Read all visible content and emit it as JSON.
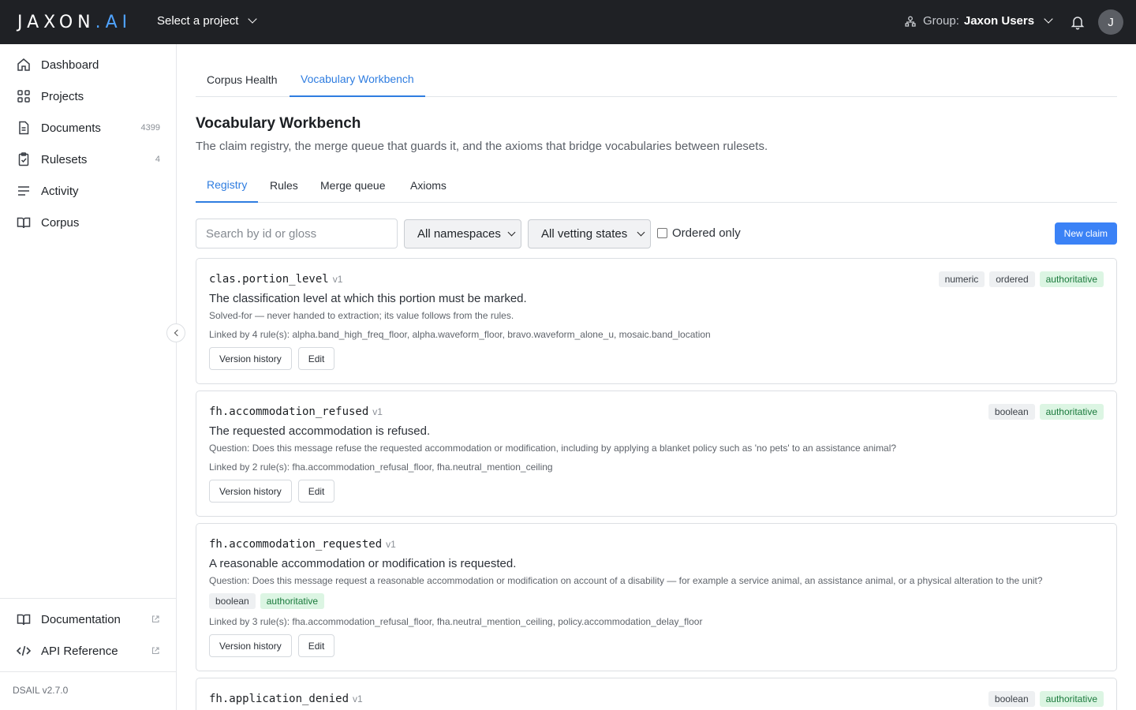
{
  "app": {
    "logo_main": "JAXON",
    "logo_dot": ".",
    "logo_accent": "AI",
    "project_select": "Select a project",
    "group_label": "Group:",
    "group_name": "Jaxon Users",
    "avatar_initial": "J"
  },
  "sidebar": {
    "items": [
      {
        "label": "Dashboard",
        "count": ""
      },
      {
        "label": "Projects",
        "count": ""
      },
      {
        "label": "Documents",
        "count": "4399"
      },
      {
        "label": "Rulesets",
        "count": "4"
      },
      {
        "label": "Activity",
        "count": ""
      },
      {
        "label": "Corpus",
        "count": ""
      }
    ],
    "bottom": [
      {
        "label": "Documentation"
      },
      {
        "label": "API Reference"
      }
    ],
    "version": "DSAIL v2.7.0"
  },
  "tabs": {
    "top": [
      "Corpus Health",
      "Vocabulary Workbench"
    ],
    "top_active": "Vocabulary Workbench",
    "sub": [
      "Registry",
      "Rules",
      "Merge queue",
      "Axioms"
    ],
    "sub_active": "Registry"
  },
  "page": {
    "title": "Vocabulary Workbench",
    "description": "The claim registry, the merge queue that guards it, and the axioms that bridge vocabularies between rulesets."
  },
  "filters": {
    "search_placeholder": "Search by id or gloss",
    "namespace": "All namespaces",
    "vetting": "All vetting states",
    "ordered_label": "Ordered only",
    "new_claim": "New claim"
  },
  "claims": [
    {
      "id": "clas.portion_level",
      "version": "v1",
      "gloss": "The classification level at which this portion must be marked.",
      "note": "Solved-for — never handed to extraction; its value follows from the rules.",
      "linked": "Linked by 4 rule(s): alpha.band_high_freq_floor, alpha.waveform_floor, bravo.waveform_alone_u, mosaic.band_location",
      "tags": [
        "numeric",
        "ordered",
        "authoritative"
      ]
    },
    {
      "id": "fh.accommodation_refused",
      "version": "v1",
      "gloss": "The requested accommodation is refused.",
      "note": "Question: Does this message refuse the requested accommodation or modification, including by applying a blanket policy such as 'no pets' to an assistance animal?",
      "linked": "Linked by 2 rule(s): fha.accommodation_refusal_floor, fha.neutral_mention_ceiling",
      "tags": [
        "boolean",
        "authoritative"
      ]
    },
    {
      "id": "fh.accommodation_requested",
      "version": "v1",
      "gloss": "A reasonable accommodation or modification is requested.",
      "note": "Question: Does this message request a reasonable accommodation or modification on account of a disability — for example a service animal, an assistance animal, or a physical alteration to the unit?",
      "linked": "Linked by 3 rule(s): fha.accommodation_refusal_floor, fha.neutral_mention_ceiling, policy.accommodation_delay_floor",
      "tags": [
        "boolean",
        "authoritative"
      ]
    },
    {
      "id": "fh.application_denied",
      "version": "v1",
      "tags": [
        "boolean",
        "authoritative"
      ]
    }
  ],
  "card_buttons": {
    "history": "Version history",
    "edit": "Edit"
  }
}
